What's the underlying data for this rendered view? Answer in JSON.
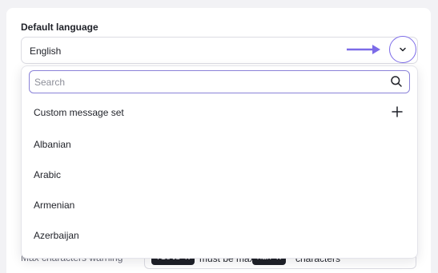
{
  "field": {
    "label": "Default language",
    "selected": "English"
  },
  "dropdown": {
    "search_placeholder": "Search",
    "options": [
      {
        "label": "Custom message set",
        "icon": "plus-icon"
      },
      {
        "label": "Albanian"
      },
      {
        "label": "Arabic"
      },
      {
        "label": "Armenian"
      },
      {
        "label": "Azerbaijan"
      }
    ]
  },
  "background_row": {
    "label": "Max characters warning",
    "token_field": "field",
    "token_k1": "K",
    "middle_text": "must be max",
    "token_max": "Max",
    "token_k2": "K",
    "end_text": "characters"
  },
  "colors": {
    "accent": "#7c6be8",
    "search_border": "#8a82d8",
    "text": "#1f2128",
    "background": "#f2f2f5"
  }
}
